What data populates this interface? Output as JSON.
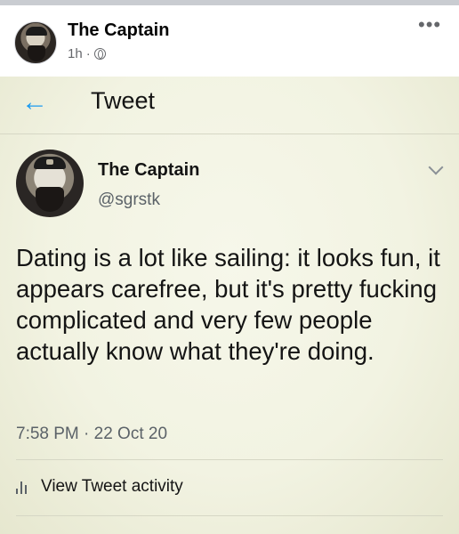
{
  "post": {
    "author": "The Captain",
    "age": "1h",
    "separator": "·",
    "privacy_icon": "globe-icon",
    "more_icon": "more-options-icon"
  },
  "tweet_header": {
    "back_icon": "arrow-left-icon",
    "title": "Tweet"
  },
  "tweet": {
    "name": "The Captain",
    "handle": "@sgrstk",
    "text": "Dating is a lot like sailing: it looks fun, it appears carefree, but it's pretty fucking complicated and very few people actually know what they're doing.",
    "timestamp": "7:58 PM · 22 Oct 20",
    "activity_label": "View Tweet activity",
    "menu_icon": "chevron-down-icon"
  },
  "colors": {
    "accent_blue": "#1d9bf0",
    "tweet_background": "#f2f3e2",
    "secondary_text": "#65676b"
  }
}
